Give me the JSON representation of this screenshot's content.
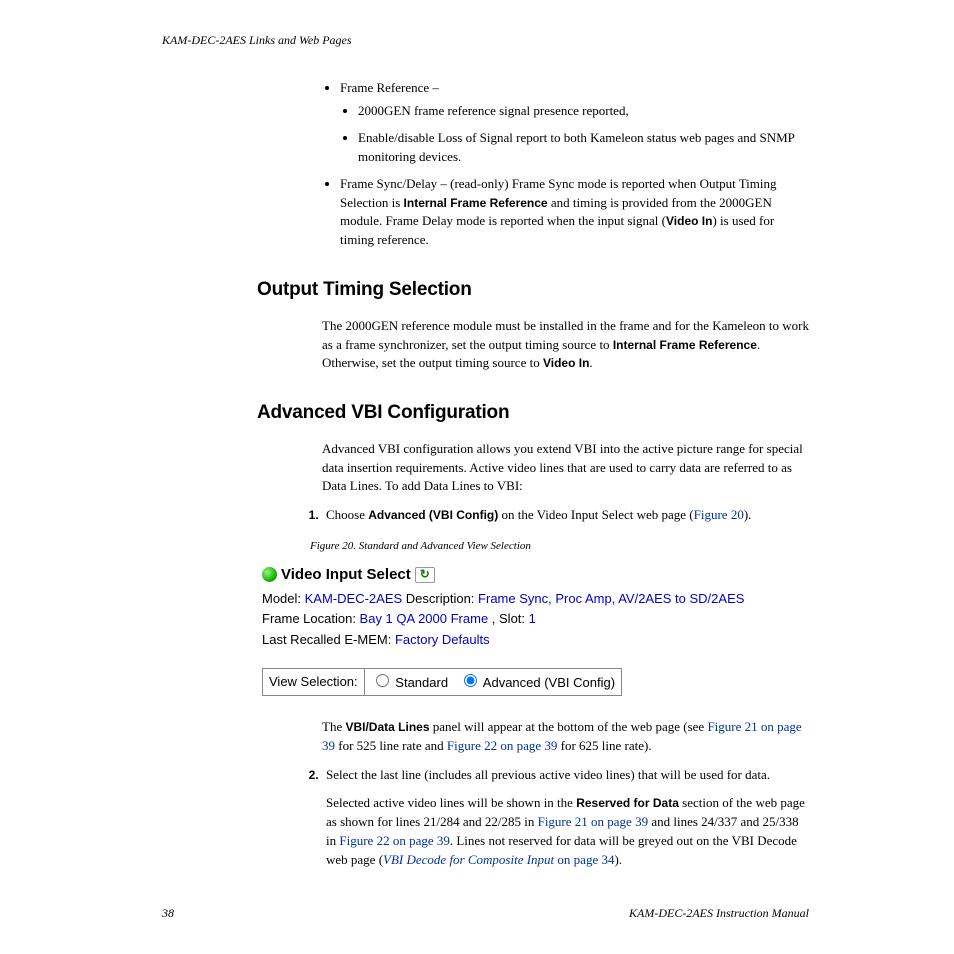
{
  "header": {
    "running": "KAM-DEC-2AES Links and Web Pages"
  },
  "bullets_top": {
    "frame_ref_label": "Frame Reference –",
    "sub1": "2000GEN frame reference signal presence reported,",
    "sub2": "Enable/disable Loss of Signal report to both Kameleon status web pages and SNMP monitoring devices.",
    "frame_sync_prefix": "Frame Sync/Delay – (read-only) Frame Sync mode is reported when Output Timing Selection is ",
    "ifr": "Internal Frame Reference",
    "frame_sync_mid": " and timing is provided from the 2000GEN module. Frame Delay mode is reported when the input signal (",
    "video_in": "Video In",
    "frame_sync_end": ") is used for timing reference."
  },
  "ots": {
    "heading": "Output Timing Selection",
    "para_pre": "The 2000GEN reference module must be installed in the frame and for the Kameleon to work as a frame synchronizer, set the output timing source to ",
    "ifr": "Internal Frame Reference",
    "para_mid": ". Otherwise, set the output timing source to ",
    "video_in": "Video In",
    "para_end": "."
  },
  "avc": {
    "heading": "Advanced VBI Configuration",
    "para": "Advanced VBI configuration allows you extend VBI into the active picture range for special data insertion requirements. Active video lines that are used to carry data are referred to as Data Lines. To add Data Lines to VBI:"
  },
  "step1": {
    "pre": "Choose ",
    "bold": "Advanced (VBI Config)",
    "mid": " on the Video Input Select web page (",
    "link": "Figure 20",
    "end": ")."
  },
  "figure": {
    "caption": "Figure 20.  Standard and Advanced View Selection",
    "title": "Video Input Select",
    "model_label": "Model: ",
    "model_val": "KAM-DEC-2AES",
    "desc_label": " Description: ",
    "desc_val": "Frame Sync, Proc Amp, AV/2AES to SD/2AES",
    "loc_label": "Frame Location: ",
    "loc_val": "Bay 1 QA 2000 Frame ",
    "slot_label": ", Slot: ",
    "slot_val": "1",
    "emem_label": "Last Recalled E-MEM: ",
    "emem_val": "Factory Defaults",
    "view_sel_label": "View Selection:",
    "opt_standard": "Standard",
    "opt_advanced": "Advanced (VBI Config)"
  },
  "para_after_fig": {
    "pre": "The ",
    "bold": "VBI/Data Lines",
    "mid": " panel will appear at the bottom of the web page (see ",
    "link1": "Figure 21 on page 39",
    "mid2": " for 525 line rate and ",
    "link2": "Figure 22 on page 39",
    "end": " for 625 line rate)."
  },
  "step2": {
    "text": "Select the last line (includes all previous active video lines) that will be used for data.",
    "p2_pre": "Selected active video lines will be shown in the ",
    "p2_bold": "Reserved for Data",
    "p2_mid": " section of the web page as shown for lines 21/284 and 22/285 in ",
    "p2_link1": "Figure 21 on page 39",
    "p2_mid2": " and lines 24/337 and 25/338 in ",
    "p2_link2": "Figure 22 on page 39",
    "p2_mid3": ". Lines not reserved for data will be greyed out on the VBI Decode web page (",
    "p2_link3": "VBI Decode for Composite Input",
    "p2_link3_suffix": " on page 34",
    "p2_end": ")."
  },
  "footer": {
    "page": "38",
    "manual": "KAM-DEC-2AES Instruction Manual"
  }
}
